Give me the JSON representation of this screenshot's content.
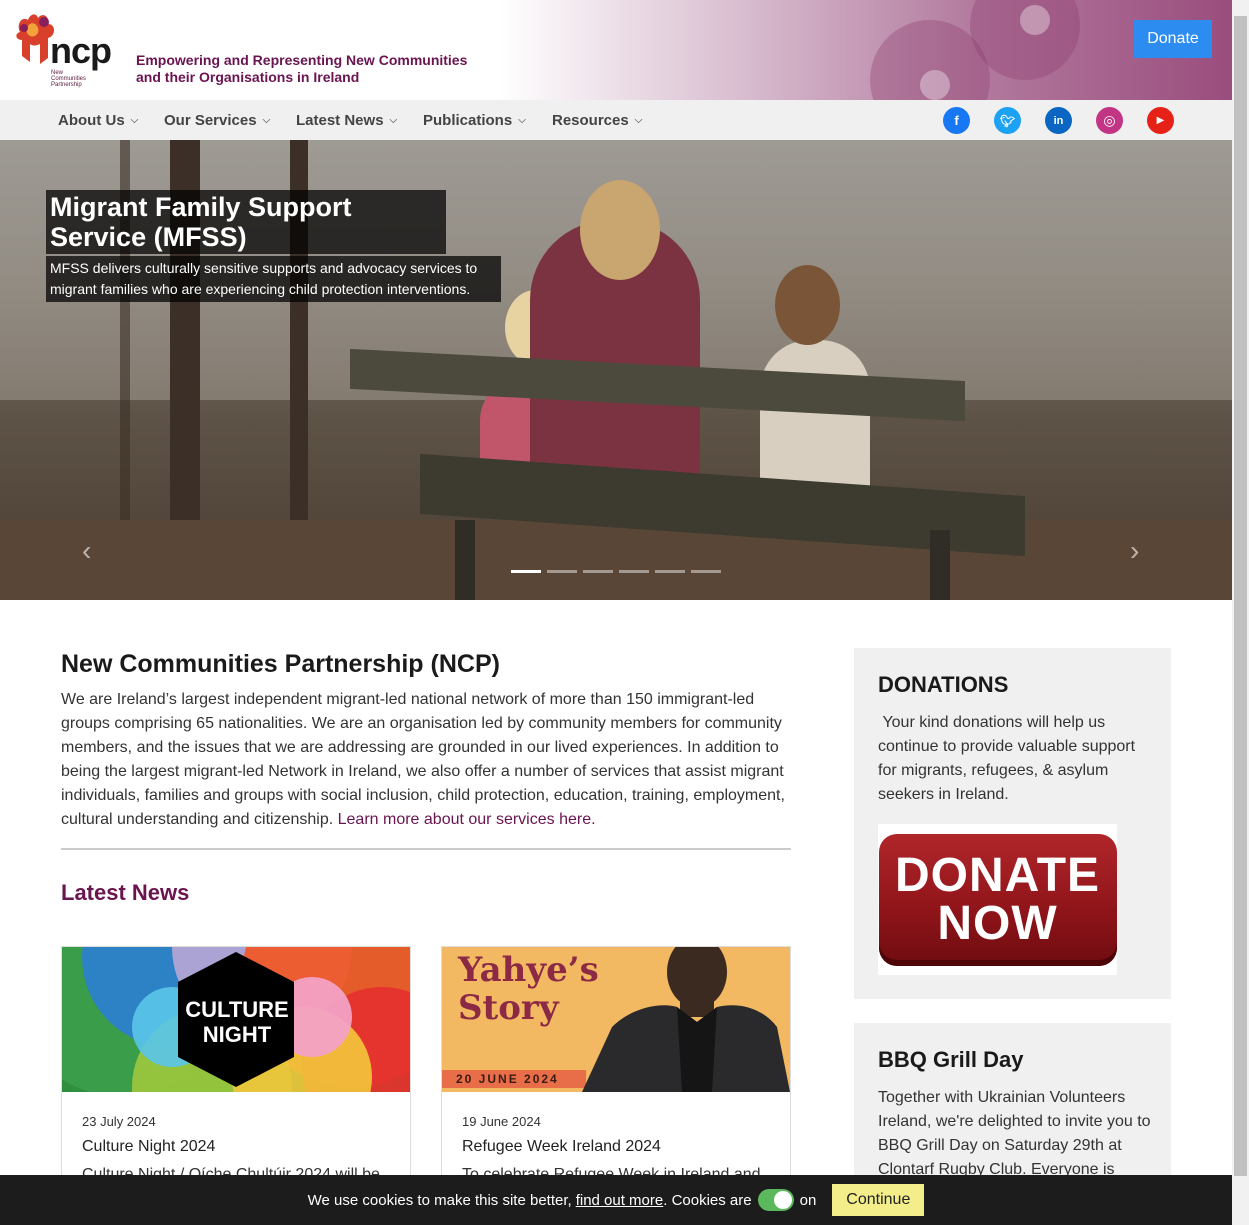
{
  "header": {
    "logo_text": "ncp",
    "logo_sub": "New Communities Partnership",
    "tagline_line1": "Empowering and Representing New Communities",
    "tagline_line2": "and their Organisations in Ireland",
    "donate_label": "Donate"
  },
  "nav": {
    "items": [
      {
        "label": "About Us"
      },
      {
        "label": "Our Services"
      },
      {
        "label": "Latest News"
      },
      {
        "label": "Publications"
      },
      {
        "label": "Resources"
      }
    ],
    "social": [
      {
        "icon": "facebook-icon",
        "glyph": "f",
        "color": "#1877f2"
      },
      {
        "icon": "twitter-icon",
        "glyph": "t",
        "color": "#1da1f2"
      },
      {
        "icon": "linkedin-icon",
        "glyph": "in",
        "color": "#0a66c2"
      },
      {
        "icon": "instagram-icon",
        "glyph": "◎",
        "color": "#c13584"
      },
      {
        "icon": "youtube-icon",
        "glyph": "▶",
        "color": "#e62117"
      }
    ]
  },
  "hero": {
    "title": "Migrant Family Support Service (MFSS)",
    "description": "MFSS delivers culturally sensitive supports and advocacy services to migrant families who are experiencing child protection interventions.",
    "slide_count": 6,
    "active_slide": 1
  },
  "main": {
    "title": "New Communities Partnership (NCP)",
    "body": "We are Ireland’s largest independent migrant-led national network of more than 150 immigrant-led groups comprising 65 nationalities. We are an organisation led by community members for community members, and the issues that we are addressing are grounded in our lived experiences. In addition to being the largest migrant-led Network in Ireland, we also offer a number of services that assist migrant individuals, families and groups with social inclusion, child protection, education, training, employment, cultural understanding and citizenship. ",
    "link": "Learn more about our services here."
  },
  "news": {
    "heading": "Latest News",
    "cards": [
      {
        "image_text": "CULTURE NIGHT",
        "date": "23 July 2024",
        "title": "Culture Night 2024",
        "excerpt": "Culture Night / Oíche Chultúir 2024 will be"
      },
      {
        "image_title": "Yahye’s Story",
        "image_date": "20 JUNE 2024",
        "date": "19 June 2024",
        "title": "Refugee Week Ireland 2024",
        "excerpt": "To celebrate Refugee Week in Ireland and"
      }
    ]
  },
  "sidebar": {
    "donations_title": "DONATIONS",
    "donations_text": " Your kind donations will help us continue to provide valuable support for migrants, refugees, & asylum seekers in Ireland.",
    "donate_image_text": "DONATE NOW",
    "bbq_title": "BBQ Grill Day",
    "bbq_text": "Together with Ukrainian Volunteers Ireland, we're delighted to invite you to BBQ Grill Day on Saturday 29th at Clontarf Rugby Club. Everyone is"
  },
  "cookie": {
    "text": "We use cookies to make this site better,",
    "link": "find out more",
    "text2": ". Cookies are",
    "state": "on",
    "button": "Continue"
  }
}
